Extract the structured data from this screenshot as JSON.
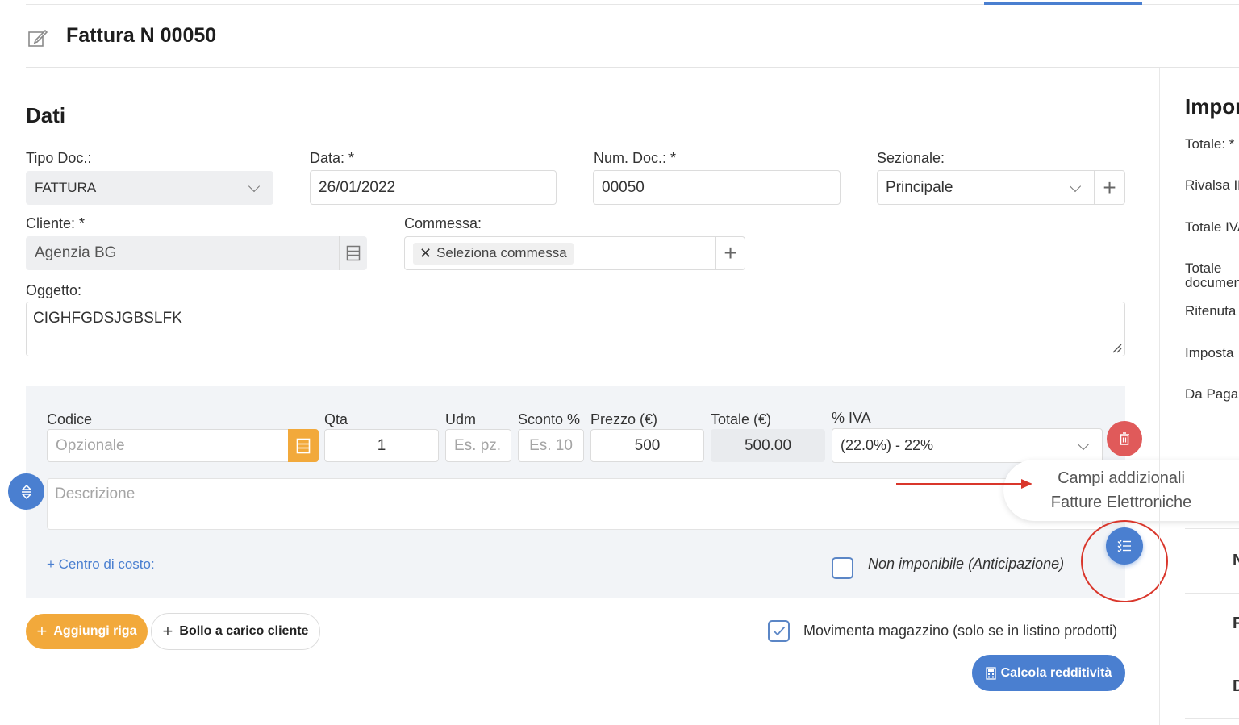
{
  "header": {
    "title": "Fattura N 00050"
  },
  "section": {
    "title": "Dati"
  },
  "form": {
    "tipo_doc": {
      "label": "Tipo Doc.:",
      "value": "FATTURA"
    },
    "data": {
      "label": "Data: *",
      "value": "26/01/2022"
    },
    "num_doc": {
      "label": "Num. Doc.: *",
      "value": "00050"
    },
    "sezionale": {
      "label": "Sezionale:",
      "value": "Principale"
    },
    "cliente": {
      "label": "Cliente: *",
      "value": "Agenzia BG"
    },
    "commessa": {
      "label": "Commessa:",
      "value": "Seleziona commessa"
    },
    "oggetto": {
      "label": "Oggetto:",
      "value": "CIGHFGDSJGBSLFK"
    }
  },
  "row": {
    "headers": {
      "codice": "Codice",
      "qta": "Qta",
      "udm": "Udm",
      "sconto": "Sconto %",
      "prezzo": "Prezzo (€)",
      "totale": "Totale (€)",
      "iva": "% IVA"
    },
    "codice_placeholder": "Opzionale",
    "qta": "1",
    "udm_placeholder": "Es. pz.",
    "sconto_placeholder": "Es. 10",
    "prezzo": "500",
    "totale": "500.00",
    "iva": "(22.0%) - 22%",
    "descrizione_placeholder": "Descrizione",
    "centro_costo": "+ Centro di costo:",
    "non_imponibile": "Non imponibile (Anticipazione)"
  },
  "tooltip": {
    "line1": "Campi addizionali",
    "line2": "Fatture Elettroniche"
  },
  "actions": {
    "aggiungi_riga": "Aggiungi riga",
    "bollo": "Bollo a carico cliente",
    "movimenta": "Movimenta magazzino (solo se in listino prodotti)",
    "calcola": "Calcola redditività"
  },
  "sidebar": {
    "title": "Impor",
    "items": [
      "Totale: *",
      "Rivalsa IN",
      "Totale IVA",
      "Totale",
      "documen",
      "Ritenuta",
      "Imposta",
      "Da Pagar"
    ],
    "letters": [
      "N",
      "F",
      "D"
    ]
  },
  "colors": {
    "accent_blue": "#4a7fd0",
    "orange": "#f2a93b",
    "red": "#e05a5a",
    "annotation_red": "#d9362b"
  },
  "icons": {
    "edit": "edit-icon",
    "chevron": "chevron-down-icon",
    "list": "list-icon",
    "plus": "plus-icon",
    "trash": "trash-icon",
    "reorder": "reorder-icon",
    "checklist": "checklist-icon",
    "calculator": "calculator-icon"
  }
}
